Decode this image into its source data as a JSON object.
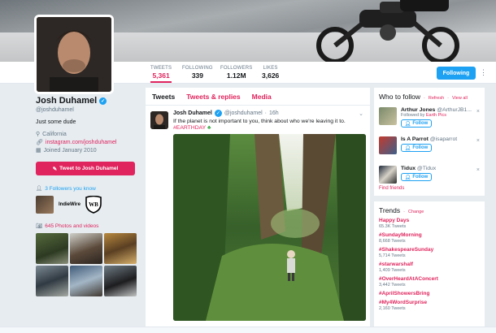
{
  "profile": {
    "name": "Josh Duhamel",
    "handle": "@joshduhamel",
    "bio": "Just some dude",
    "location": "California",
    "website": "instagram.com/joshduhamel",
    "joined": "Joined January 2010",
    "tweet_to_label": "Tweet to Josh Duhamel",
    "followers_you_know": "3 Followers you know",
    "photos_videos": "645 Photos and videos",
    "indie_label": "IndieWire"
  },
  "stats": [
    {
      "label": "TWEETS",
      "value": "5,361"
    },
    {
      "label": "FOLLOWING",
      "value": "339"
    },
    {
      "label": "FOLLOWERS",
      "value": "1.12M"
    },
    {
      "label": "LIKES",
      "value": "3,626"
    }
  ],
  "header": {
    "following_label": "Following",
    "more_icon": "more-vertical-icon"
  },
  "timeline": {
    "tabs": [
      "Tweets",
      "Tweets & replies",
      "Media"
    ],
    "tweet": {
      "name": "Josh Duhamel",
      "handle": "@joshduhamel",
      "time": "16h",
      "text": "If the planet is not important to you, think about who we're leaving it to.",
      "hashtag": "#EARTHDAY"
    }
  },
  "who_to_follow": {
    "title": "Who to follow",
    "refresh": "Refresh",
    "view_all": "View all",
    "follow_label": "Follow",
    "find_friends": "Find friends",
    "items": [
      {
        "name": "Arthur Jones",
        "handle": "@ArthurJB1...",
        "sub_prefix": "Followed by",
        "sub_highlight": "Earth Pics"
      },
      {
        "name": "Is A Parrot",
        "handle": "@isaparrot",
        "sub_prefix": "",
        "sub_highlight": ""
      },
      {
        "name": "Tidux",
        "handle": "@Tidux",
        "sub_prefix": "",
        "sub_highlight": ""
      }
    ]
  },
  "trends": {
    "title": "Trends",
    "change": "Change",
    "items": [
      {
        "name": "Happy Days",
        "count": "65.3K Tweets"
      },
      {
        "name": "#SundayMorning",
        "count": "8,668 Tweets"
      },
      {
        "name": "#ShakespeareSunday",
        "count": "5,714 Tweets"
      },
      {
        "name": "#starwarshalf",
        "count": "1,409 Tweets"
      },
      {
        "name": "#OverHeardAtAConcert",
        "count": "3,442 Tweets"
      },
      {
        "name": "#AprilShowersBring",
        "count": ""
      },
      {
        "name": "#My4WordSurprise",
        "count": "2,160 Tweets"
      }
    ]
  },
  "colors": {
    "accent": "#e0245e",
    "blue": "#1da1f2"
  }
}
